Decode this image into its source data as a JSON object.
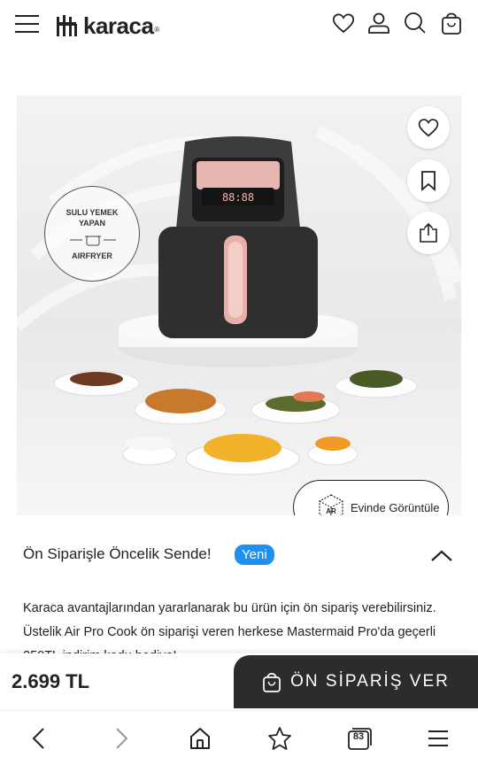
{
  "header": {
    "brand": "karaca",
    "brand_mark": "®",
    "icons": [
      "menu-icon",
      "heart-icon",
      "user-icon",
      "search-icon",
      "bag-icon"
    ]
  },
  "product_image": {
    "badge": {
      "line1": "SULU YEMEK",
      "line2": "YAPAN",
      "line3": "AIRFRYER"
    },
    "display_digits": "88:88",
    "ar_button_label": "Evinde Görüntüle",
    "ar_icon_text": "AR",
    "side_actions": [
      "favorite-icon",
      "bookmark-icon",
      "share-icon"
    ]
  },
  "product": {
    "title": "Ön Siparişle Öncelik Sende!",
    "new_badge": "Yeni",
    "description": "Karaca avantajlarından yararlanarak bu ürün için ön sipariş verebilirsiniz. Üstelik Air Pro Cook ön siparişi veren herkese Mastermaid Pro'da geçerli 250TL indirim kodu hediye!"
  },
  "buy_bar": {
    "price": "2.699 TL",
    "preorder_label": "ÖN SİPARİŞ VER"
  },
  "browser_nav": {
    "tab_count": "83",
    "icons": [
      "back-icon",
      "forward-icon",
      "home-icon",
      "star-icon",
      "tabs-icon",
      "menu-icon"
    ]
  }
}
